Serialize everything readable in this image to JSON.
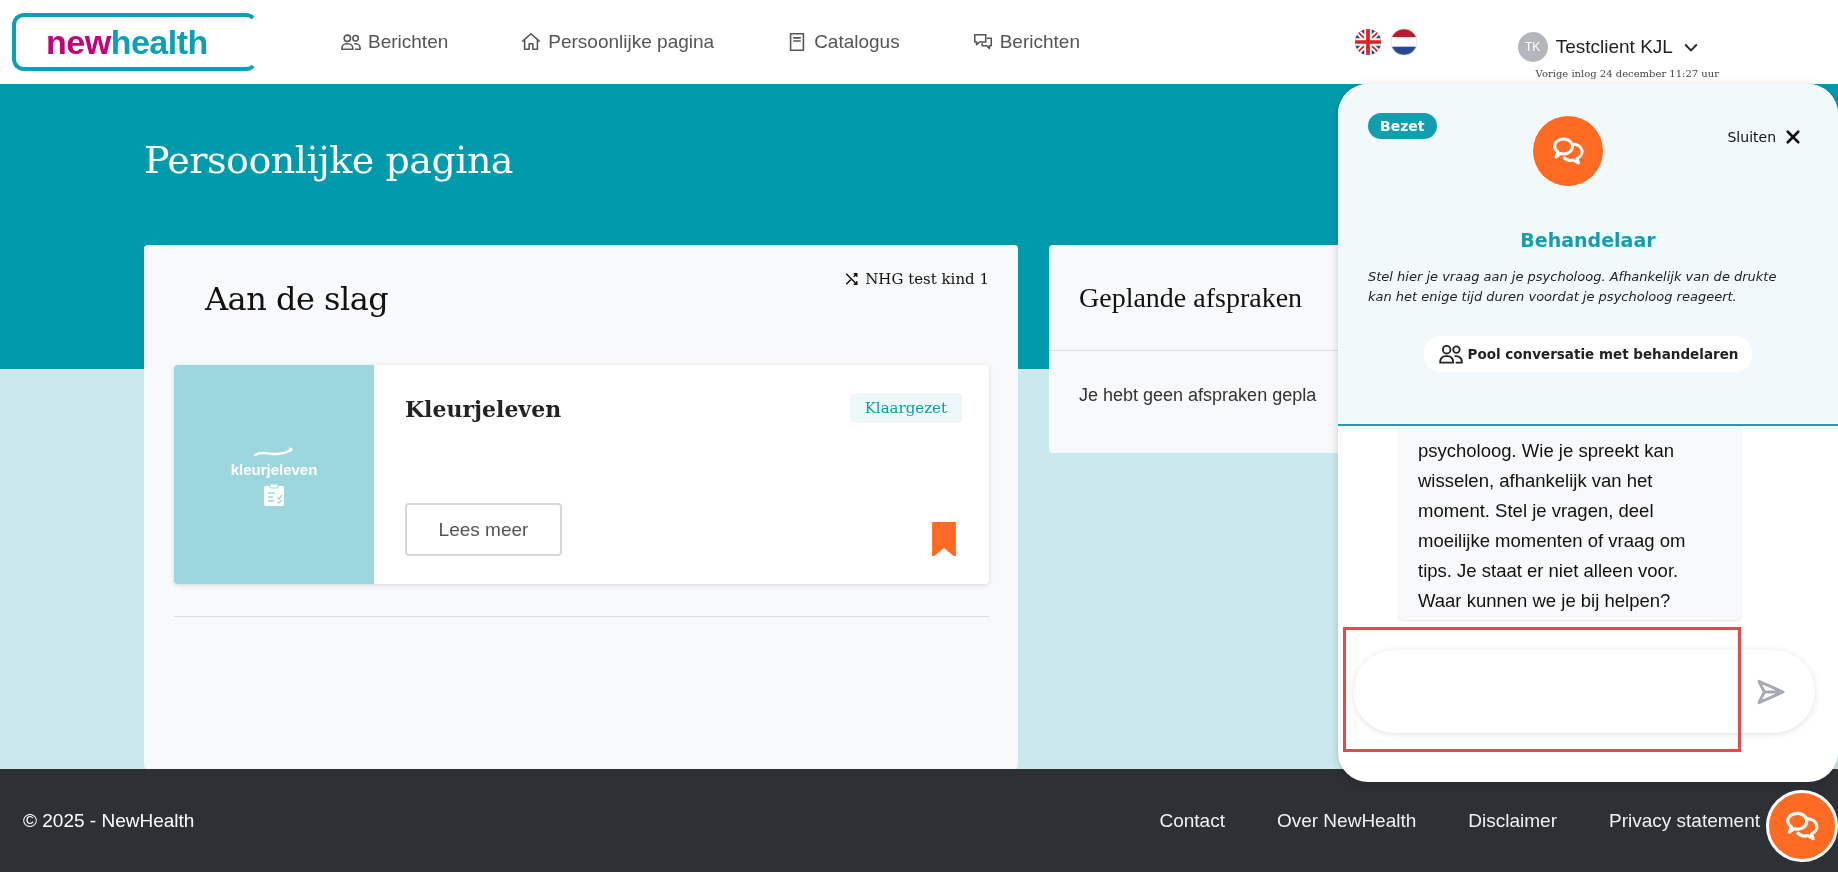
{
  "header": {
    "logo": {
      "part_1": "new",
      "part_2": "health"
    },
    "nav": [
      {
        "label": "Berichten",
        "kind": "people"
      },
      {
        "label": "Persoonlijke pagina",
        "kind": "home"
      },
      {
        "label": "Catalogus",
        "kind": "book"
      },
      {
        "label": "Berichten",
        "kind": "chat"
      }
    ],
    "languages": [
      {
        "kind": "uk"
      },
      {
        "kind": "nl"
      }
    ],
    "user": {
      "initials": "TK",
      "name": "Testclient KJL",
      "last_login": "Vorige inlog 24 december 11:27 uur"
    }
  },
  "page": {
    "title": "Persoonlijke pagina"
  },
  "getting_started": {
    "title": "Aan de slag",
    "child": "NHG test kind 1",
    "items": [
      {
        "title": "Kleurjeleven",
        "logo_text": "kleurjeleven",
        "status": "Klaargezet",
        "button": "Lees meer",
        "bookmarked": true
      }
    ]
  },
  "appointments": {
    "title": "Geplande afspraken",
    "empty": "Je hebt geen afspraken gepla"
  },
  "chat": {
    "status": "Bezet",
    "close": "Sluiten",
    "title": "Behandelaar",
    "intro": "Stel hier je vraag aan je psycholoog. Afhankelijk van de drukte kan het enige tijd duren voordat je psycholoog reageert.",
    "pool_button": "Pool conversatie met behandelaren",
    "messages": [
      {
        "text": "psycholoog. Wie je spreekt kan wisselen, afhankelijk van het moment. Stel je vragen, deel moeilijke momenten of vraag om tips. Je staat er niet alleen voor. Waar kunnen we je bij helpen?"
      }
    ],
    "input_highlighted": true
  },
  "footer": {
    "copyright": "© 2025 - NewHealth",
    "links": [
      "Contact",
      "Over NewHealth",
      "Disclaimer",
      "Privacy statement"
    ]
  }
}
